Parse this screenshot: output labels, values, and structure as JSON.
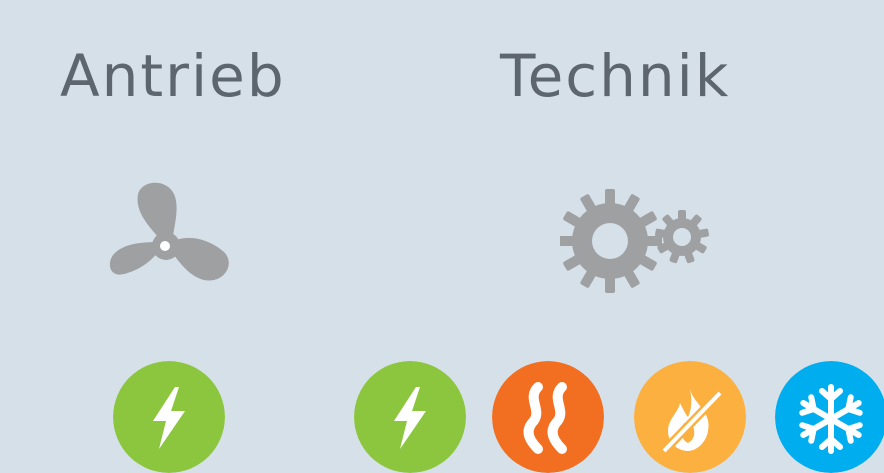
{
  "sections": {
    "antrieb": {
      "title": "Antrieb",
      "icon": "propeller-icon",
      "badges": [
        {
          "icon": "lightning-icon",
          "color": "#8cc63f"
        }
      ]
    },
    "technik": {
      "title": "Technik",
      "icon": "gears-icon",
      "badges": [
        {
          "icon": "lightning-icon",
          "color": "#8cc63f"
        },
        {
          "icon": "heat-waves-icon",
          "color": "#f26f21"
        },
        {
          "icon": "no-fire-icon",
          "color": "#fbb040"
        },
        {
          "icon": "snowflake-icon",
          "color": "#00aeef"
        }
      ]
    }
  },
  "colors": {
    "background": "#d6e0e9",
    "heading": "#5d666e",
    "icon_gray": "#9ea0a2"
  }
}
